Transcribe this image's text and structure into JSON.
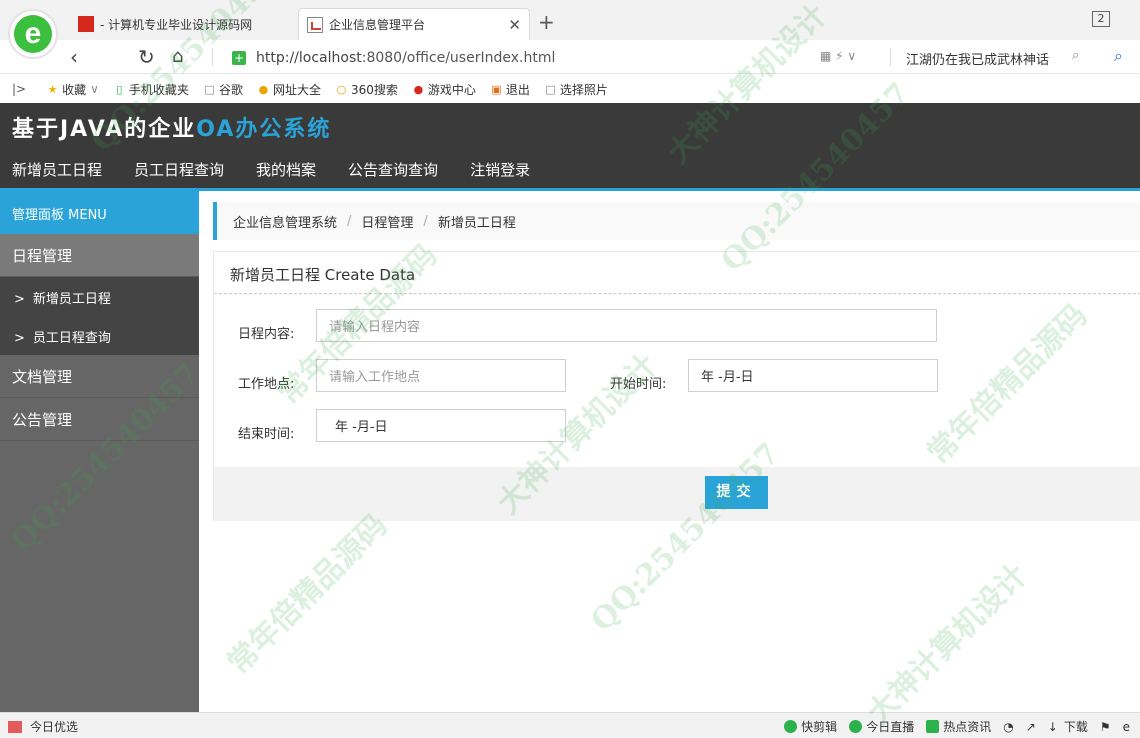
{
  "browser": {
    "tabs": [
      {
        "title": "- 计算机专业毕业设计源码网"
      },
      {
        "title": "企业信息管理平台"
      }
    ],
    "new_tab": "+",
    "tab_count": "2",
    "url_host": "http://localhost",
    "url_rest": ":8080/office/userIndex.html",
    "search_hint": "江湖仍在我已成武林神话",
    "bookmarks": [
      "收藏",
      "手机收藏夹",
      "谷歌",
      "网址大全",
      "360搜索",
      "游戏中心",
      "退出",
      "选择照片"
    ]
  },
  "app": {
    "brand_main": "基于JAVA的企业",
    "brand_accent": "OA办公系统",
    "nav": [
      "新增员工日程",
      "员工日程查询",
      "我的档案",
      "公告查询查询",
      "注销登录"
    ]
  },
  "sidebar": {
    "title": "管理面板 MENU",
    "group1": "日程管理",
    "sub1": "新增员工日程",
    "sub2": "员工日程查询",
    "group2": "文档管理",
    "group3": "公告管理"
  },
  "breadcrumb": [
    "企业信息管理系统",
    "日程管理",
    "新增员工日程"
  ],
  "form": {
    "title": "新增员工日程 Create Data",
    "content_label": "日程内容:",
    "content_placeholder": "请输入日程内容",
    "place_label": "工作地点:",
    "place_placeholder": "请输入工作地点",
    "start_label": "开始时间:",
    "start_value": "年 -月-日",
    "end_label": "结束时间:",
    "end_value": "年 -月-日",
    "submit": "提交"
  },
  "status": {
    "left": "今日优选",
    "items": [
      "快剪辑",
      "今日直播",
      "热点资讯",
      "下载"
    ]
  },
  "watermark": [
    "QQ:254540457",
    "大神计算机设计",
    "常年倍精品源码",
    "QQ:254540457",
    "常年倍精品源码",
    "大神计算机设计",
    "QQ:254540457",
    "常年倍精品源码",
    "大神计算机设计",
    "QQ:254540457"
  ]
}
